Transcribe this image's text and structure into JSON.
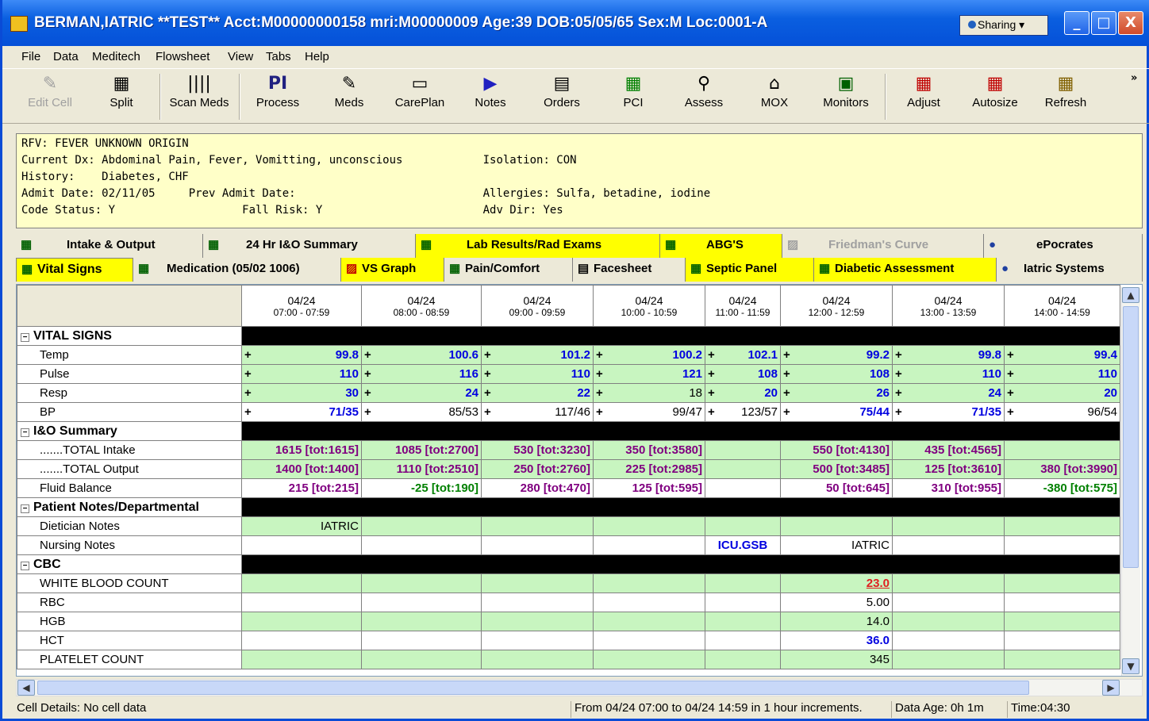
{
  "window": {
    "title": "BERMAN,IATRIC **TEST** Acct:M00000000158 mri:M00000009 Age:39 DOB:05/05/65 Sex:M Loc:0001-A",
    "sharing_label": "Sharing",
    "minimize": "_",
    "maximize": "□",
    "close": "X"
  },
  "menu": [
    "File",
    "Data",
    "Meditech",
    "Flowsheet",
    "View",
    "Tabs",
    "Help"
  ],
  "toolbar": [
    {
      "label": "Edit Cell",
      "icon": "✎"
    },
    {
      "label": "Split",
      "icon": "▦"
    },
    {
      "label": "Scan Meds",
      "icon": "||||"
    },
    {
      "label": "Process",
      "icon": "PI"
    },
    {
      "label": "Meds",
      "icon": "✎"
    },
    {
      "label": "CarePlan",
      "icon": "▭"
    },
    {
      "label": "Notes",
      "icon": "▶"
    },
    {
      "label": "Orders",
      "icon": "▤"
    },
    {
      "label": "PCI",
      "icon": "▦"
    },
    {
      "label": "Assess",
      "icon": "⚲"
    },
    {
      "label": "MOX",
      "icon": "⌂"
    },
    {
      "label": "Monitors",
      "icon": "▣"
    },
    {
      "label": "Adjust",
      "icon": "▦"
    },
    {
      "label": "Autosize",
      "icon": "▦"
    },
    {
      "label": "Refresh",
      "icon": "▦"
    }
  ],
  "toolbar_overflow": "»",
  "info": {
    "line1": "RFV: FEVER UNKNOWN ORIGIN",
    "line2": "Current Dx: Abdominal Pain, Fever, Vomitting, unconscious            Isolation: CON",
    "line3": "History:    Diabetes, CHF",
    "line4": "Admit Date: 02/11/05     Prev Admit Date:                            Allergies: Sulfa, betadine, iodine",
    "line5": "Code Status: Y                   Fall Risk: Y                        Adv Dir: Yes"
  },
  "tabs_row1": [
    "Intake & Output",
    "24 Hr I&O Summary",
    "Lab Results/Rad Exams",
    "ABG'S",
    "Friedman's Curve",
    "ePocrates"
  ],
  "tabs_row2": [
    "Vital Signs",
    "Medication (05/02 1006)",
    "VS Graph",
    "Pain/Comfort",
    "Facesheet",
    "Septic Panel",
    "Diabetic Assessment",
    "Iatric Systems"
  ],
  "columns": [
    {
      "date": "04/24",
      "time": "07:00 - 07:59"
    },
    {
      "date": "04/24",
      "time": "08:00 - 08:59"
    },
    {
      "date": "04/24",
      "time": "09:00 - 09:59"
    },
    {
      "date": "04/24",
      "time": "10:00 - 10:59"
    },
    {
      "date": "04/24",
      "time": "11:00 - 11:59"
    },
    {
      "date": "04/24",
      "time": "12:00 - 12:59"
    },
    {
      "date": "04/24",
      "time": "13:00 - 13:59"
    },
    {
      "date": "04/24",
      "time": "14:00 - 14:59"
    }
  ],
  "sections": {
    "vital": "VITAL SIGNS",
    "io": "I&O Summary",
    "notes": "Patient Notes/Departmental",
    "cbc": "CBC"
  },
  "rows": {
    "temp": {
      "label": "Temp",
      "vals": [
        "99.8",
        "100.6",
        "101.2",
        "100.2",
        "102.1",
        "99.2",
        "99.8",
        "99.4"
      ]
    },
    "pulse": {
      "label": "Pulse",
      "vals": [
        "110",
        "116",
        "110",
        "121",
        "108",
        "108",
        "110",
        "110"
      ]
    },
    "resp": {
      "label": "Resp",
      "vals": [
        "30",
        "24",
        "22",
        "18",
        "20",
        "26",
        "24",
        "20"
      ]
    },
    "bp": {
      "label": "BP",
      "vals": [
        "71/35",
        "85/53",
        "117/46",
        "99/47",
        "123/57",
        "75/44",
        "71/35",
        "96/54"
      ]
    },
    "intake": {
      "label": ".......TOTAL Intake",
      "vals": [
        "1615 [tot:1615]",
        "1085 [tot:2700]",
        "530 [tot:3230]",
        "350 [tot:3580]",
        "",
        "550 [tot:4130]",
        "435 [tot:4565]",
        ""
      ]
    },
    "output": {
      "label": ".......TOTAL Output",
      "vals": [
        "1400 [tot:1400]",
        "1110 [tot:2510]",
        "250 [tot:2760]",
        "225 [tot:2985]",
        "",
        "500 [tot:3485]",
        "125 [tot:3610]",
        "380 [tot:3990]"
      ]
    },
    "balance": {
      "label": "Fluid Balance",
      "vals": [
        "215 [tot:215]",
        "-25 [tot:190]",
        "280 [tot:470]",
        "125 [tot:595]",
        "",
        "50 [tot:645]",
        "310 [tot:955]",
        "-380 [tot:575]"
      ]
    },
    "diet": {
      "label": "Dietician Notes",
      "vals": [
        "IATRIC",
        "",
        "",
        "",
        "",
        "",
        "",
        ""
      ]
    },
    "nursing": {
      "label": "Nursing Notes",
      "vals": [
        "",
        "",
        "",
        "",
        "ICU.GSB",
        "IATRIC",
        "",
        ""
      ]
    },
    "wbc": {
      "label": "WHITE BLOOD COUNT",
      "vals": [
        "",
        "",
        "",
        "",
        "",
        "23.0",
        "",
        ""
      ]
    },
    "rbc": {
      "label": "RBC",
      "vals": [
        "",
        "",
        "",
        "",
        "",
        "5.00",
        "",
        ""
      ]
    },
    "hgb": {
      "label": "HGB",
      "vals": [
        "",
        "",
        "",
        "",
        "",
        "14.0",
        "",
        ""
      ]
    },
    "hct": {
      "label": "HCT",
      "vals": [
        "",
        "",
        "",
        "",
        "",
        "36.0",
        "",
        ""
      ]
    },
    "plt": {
      "label": "PLATELET COUNT",
      "vals": [
        "",
        "",
        "",
        "",
        "",
        "345",
        "",
        ""
      ]
    }
  },
  "status": {
    "cell": "Cell Details: No cell data",
    "range": "From 04/24 07:00 to 04/24 14:59 in 1 hour increments.",
    "age": "Data Age: 0h 1m",
    "time": "Time:04:30"
  }
}
